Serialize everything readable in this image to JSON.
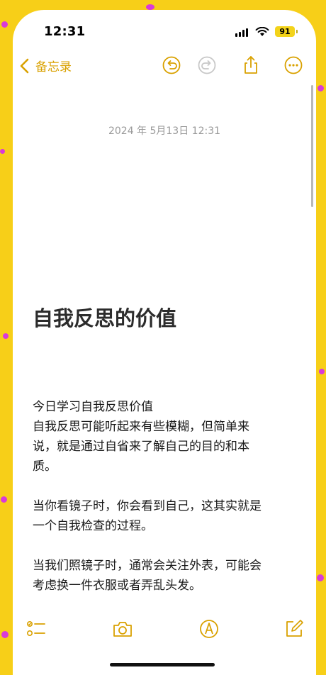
{
  "status_bar": {
    "time": "12:31",
    "battery": "91"
  },
  "nav": {
    "back_label": "备忘录",
    "icons": [
      "undo-icon",
      "redo-icon",
      "share-icon",
      "more-icon"
    ],
    "accent_color": "#d9a100"
  },
  "note": {
    "date": "2024 年 5月13日 12:31",
    "title": "自我反思的价值",
    "paragraphs": [
      [
        "今日学习自我反思价值",
        "自我反思可能听起来有些模糊，但简单来",
        "说，就是通过自省来了解自己的目的和本",
        "质。"
      ],
      [
        "当你看镜子时，你会看到自己，这其实就是",
        "一个自我检查的过程。"
      ],
      [
        "当我们照镜子时，通常会关注外表，可能会",
        "考虑换一件衣服或者弄乱头发。"
      ]
    ]
  },
  "toolbar": {
    "icons": [
      "checklist-icon",
      "camera-icon",
      "markup-icon",
      "compose-icon"
    ]
  }
}
